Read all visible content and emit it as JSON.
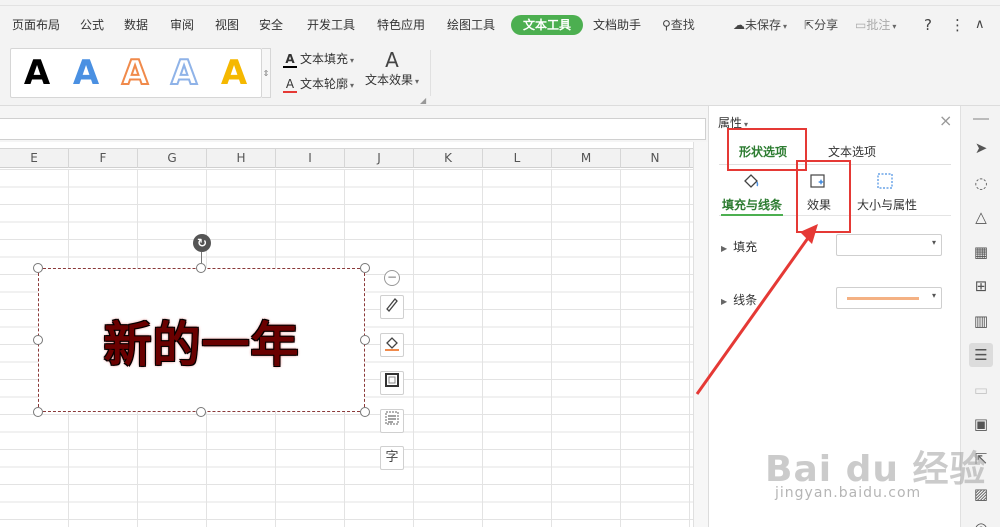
{
  "menubar": {
    "items": [
      "页面布局",
      "公式",
      "数据",
      "审阅",
      "视图",
      "安全",
      "开发工具",
      "特色应用",
      "绘图工具",
      "文本工具",
      "文档助手"
    ],
    "active": "文本工具",
    "search_label": "查找",
    "search_icon": "search-icon",
    "unsaved_label": "未保存",
    "share_label": "分享",
    "comment_label": "批注",
    "help_label": "?",
    "more_label": "⋮",
    "collapse_label": "∧"
  },
  "ribbon": {
    "style_glyph": "A",
    "styles": [
      {
        "name": "black",
        "color": "#000000"
      },
      {
        "name": "blue",
        "color": "#4a90e2"
      },
      {
        "name": "orange-outline",
        "color": "#f08a4b"
      },
      {
        "name": "blue-outline",
        "color": "#8fb3e8"
      },
      {
        "name": "yellow",
        "color": "#f5b800"
      }
    ],
    "text_fill_label": "文本填充",
    "text_outline_label": "文本轮廓",
    "text_effect_label": "文本效果",
    "glyph_a": "A"
  },
  "sheet": {
    "columns": [
      "E",
      "F",
      "G",
      "H",
      "I",
      "J",
      "K",
      "L",
      "M",
      "N"
    ],
    "textbox_text": "新的一年"
  },
  "floating_toolbar": {
    "icons": [
      "brush-icon",
      "fill-bucket-icon",
      "frame-icon",
      "text-wrap-icon",
      "font-icon"
    ],
    "font_glyph": "字"
  },
  "properties": {
    "title": "属性",
    "tabs": [
      "形状选项",
      "文本选项"
    ],
    "active_tab": "形状选项",
    "subtabs": [
      "填充与线条",
      "效果",
      "大小与属性"
    ],
    "active_subtab": "填充与线条",
    "rows": [
      {
        "label": "填充"
      },
      {
        "label": "线条",
        "line_color": "#f4b183"
      }
    ]
  },
  "rail": {
    "icons": [
      "cursor-icon",
      "shapes-icon",
      "style-icon",
      "table-icon",
      "grid-icon",
      "chart-icon",
      "properties-icon",
      "blank-icon",
      "image-icon",
      "share-icon",
      "picture-icon",
      "bottom-icon"
    ],
    "active_icon": "properties-icon"
  },
  "watermark": {
    "logo": "Bai du 经验",
    "url": "jingyan.baidu.com"
  },
  "annotation_color": "#e53935"
}
